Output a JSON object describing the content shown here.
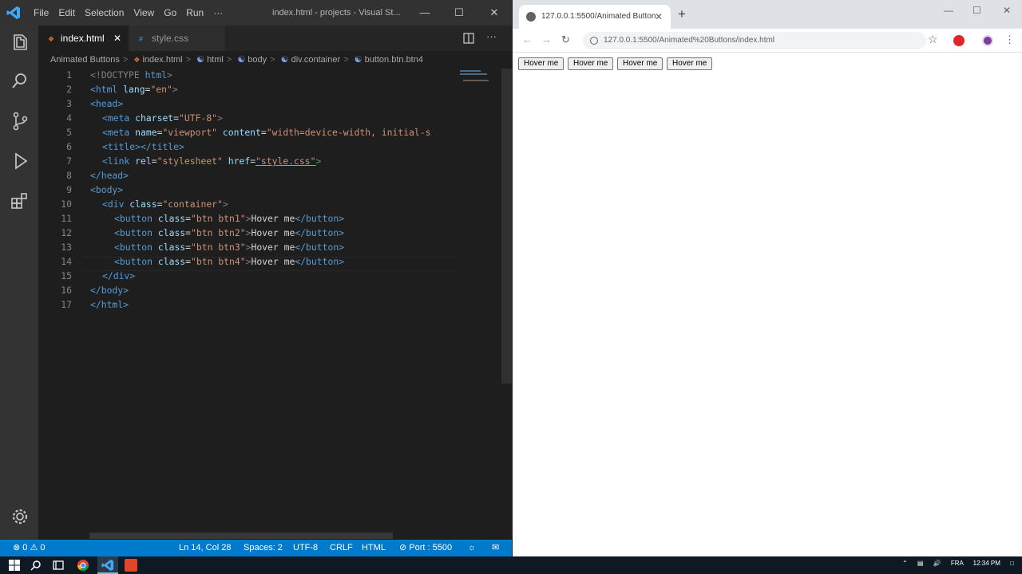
{
  "vscode": {
    "menu": [
      "File",
      "Edit",
      "Selection",
      "View",
      "Go",
      "Run",
      "···"
    ],
    "window_title": "index.html - projects - Visual St...",
    "tabs": [
      {
        "label": "index.html",
        "icon": "html-file-icon",
        "active": true
      },
      {
        "label": "style.css",
        "icon": "css-file-icon",
        "active": false
      }
    ],
    "breadcrumb": [
      "Animated Buttons",
      "index.html",
      "html",
      "body",
      "div.container",
      "button.btn.btn4"
    ],
    "code_lines": [
      {
        "n": "1"
      },
      {
        "n": "2"
      },
      {
        "n": "3"
      },
      {
        "n": "4"
      },
      {
        "n": "5"
      },
      {
        "n": "6"
      },
      {
        "n": "7"
      },
      {
        "n": "8"
      },
      {
        "n": "9"
      },
      {
        "n": "10"
      },
      {
        "n": "11"
      },
      {
        "n": "12"
      },
      {
        "n": "13"
      },
      {
        "n": "14"
      },
      {
        "n": "15"
      },
      {
        "n": "16"
      },
      {
        "n": "17"
      }
    ],
    "code": {
      "l1a": "<!DOCTYPE ",
      "l1b": "html",
      "l1c": ">",
      "l2a": "<html ",
      "l2b": "lang",
      "l2c": "=",
      "l2d": "\"en\"",
      "l2e": ">",
      "l3": "<head>",
      "l4a": "<meta ",
      "l4b": "charset",
      "l4c": "=",
      "l4d": "\"UTF-8\"",
      "l4e": ">",
      "l5a": "<meta ",
      "l5b": "name",
      "l5c": "=",
      "l5d": "\"viewport\"",
      "l5e": " content",
      "l5f": "=",
      "l5g": "\"width=device-width, initial-s",
      "l6a": "<title>",
      "l6b": "</title>",
      "l7a": "<link ",
      "l7b": "rel",
      "l7c": "=",
      "l7d": "\"stylesheet\"",
      "l7e": " href",
      "l7f": "=",
      "l7g": "\"style.css\"",
      "l7h": ">",
      "l8": "</head>",
      "l9": "<body>",
      "l10a": "<div ",
      "l10b": "class",
      "l10c": "=",
      "l10d": "\"container\"",
      "l10e": ">",
      "btn_open": "<button ",
      "btn_class": "class",
      "btn_eq": "=",
      "l11d": "\"btn btn1\"",
      "l12d": "\"btn btn2\"",
      "l13d": "\"btn btn3\"",
      "l14d": "\"btn btn4\"",
      "btn_gt": ">",
      "btn_text": "Hover me",
      "btn_close": "</button>",
      "l15": "</div>",
      "l16": "</body>",
      "l17": "</html>"
    },
    "status": {
      "errors": "⊗ 0 ⚠ 0",
      "position": "Ln 14, Col 28",
      "spaces": "Spaces: 2",
      "encoding": "UTF-8",
      "eol": "CRLF",
      "language": "HTML",
      "port": "⊘ Port : 5500"
    }
  },
  "chrome": {
    "tab_title": "127.0.0.1:5500/Animated Button",
    "url": "127.0.0.1:5500/Animated%20Buttons/index.html",
    "page_buttons": [
      "Hover me",
      "Hover me",
      "Hover me",
      "Hover me"
    ]
  },
  "taskbar": {
    "tray_lang": "FRA",
    "tray_time": "12:34 PM"
  }
}
